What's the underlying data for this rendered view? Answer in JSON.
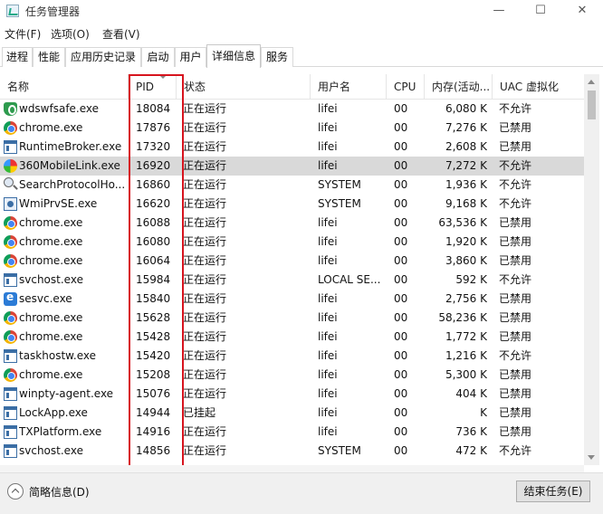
{
  "window": {
    "title": "任务管理器",
    "minimize": "—",
    "maximize": "☐",
    "close": "✕"
  },
  "menu": [
    "文件(F)",
    "选项(O)",
    "查看(V)"
  ],
  "tabs": [
    {
      "label": "进程"
    },
    {
      "label": "性能"
    },
    {
      "label": "应用历史记录"
    },
    {
      "label": "启动"
    },
    {
      "label": "用户"
    },
    {
      "label": "详细信息",
      "active": true
    },
    {
      "label": "服务"
    }
  ],
  "columns": {
    "name": "名称",
    "pid": "PID",
    "status": "状态",
    "user": "用户名",
    "cpu": "CPU",
    "memory": "内存(活动...",
    "uac": "UAC 虚拟化"
  },
  "rows": [
    {
      "icon": "shield-icon",
      "name": "wdswfsafe.exe",
      "pid": "18084",
      "status": "正在运行",
      "user": "lifei",
      "cpu": "00",
      "mem": "6,080 K",
      "uac": "不允许"
    },
    {
      "icon": "chrome-icon",
      "name": "chrome.exe",
      "pid": "17876",
      "status": "正在运行",
      "user": "lifei",
      "cpu": "00",
      "mem": "7,276 K",
      "uac": "已禁用"
    },
    {
      "icon": "window-icon",
      "name": "RuntimeBroker.exe",
      "pid": "17320",
      "status": "正在运行",
      "user": "lifei",
      "cpu": "00",
      "mem": "2,608 K",
      "uac": "已禁用"
    },
    {
      "icon": "360-icon",
      "name": "360MobileLink.exe",
      "pid": "16920",
      "status": "正在运行",
      "user": "lifei",
      "cpu": "00",
      "mem": "7,272 K",
      "uac": "不允许",
      "selected": true
    },
    {
      "icon": "search-icon",
      "name": "SearchProtocolHo...",
      "pid": "16860",
      "status": "正在运行",
      "user": "SYSTEM",
      "cpu": "00",
      "mem": "1,936 K",
      "uac": "不允许"
    },
    {
      "icon": "wmi-icon",
      "name": "WmiPrvSE.exe",
      "pid": "16620",
      "status": "正在运行",
      "user": "SYSTEM",
      "cpu": "00",
      "mem": "9,168 K",
      "uac": "不允许"
    },
    {
      "icon": "chrome-icon",
      "name": "chrome.exe",
      "pid": "16088",
      "status": "正在运行",
      "user": "lifei",
      "cpu": "00",
      "mem": "63,536 K",
      "uac": "已禁用"
    },
    {
      "icon": "chrome-icon",
      "name": "chrome.exe",
      "pid": "16080",
      "status": "正在运行",
      "user": "lifei",
      "cpu": "00",
      "mem": "1,920 K",
      "uac": "已禁用"
    },
    {
      "icon": "chrome-icon",
      "name": "chrome.exe",
      "pid": "16064",
      "status": "正在运行",
      "user": "lifei",
      "cpu": "00",
      "mem": "3,860 K",
      "uac": "已禁用"
    },
    {
      "icon": "window-icon",
      "name": "svchost.exe",
      "pid": "15984",
      "status": "正在运行",
      "user": "LOCAL SE...",
      "cpu": "00",
      "mem": "592 K",
      "uac": "不允许"
    },
    {
      "icon": "sesvc-icon",
      "name": "sesvc.exe",
      "pid": "15840",
      "status": "正在运行",
      "user": "lifei",
      "cpu": "00",
      "mem": "2,756 K",
      "uac": "已禁用"
    },
    {
      "icon": "chrome-icon",
      "name": "chrome.exe",
      "pid": "15628",
      "status": "正在运行",
      "user": "lifei",
      "cpu": "00",
      "mem": "58,236 K",
      "uac": "已禁用"
    },
    {
      "icon": "chrome-icon",
      "name": "chrome.exe",
      "pid": "15428",
      "status": "正在运行",
      "user": "lifei",
      "cpu": "00",
      "mem": "1,772 K",
      "uac": "已禁用"
    },
    {
      "icon": "window-icon",
      "name": "taskhostw.exe",
      "pid": "15420",
      "status": "正在运行",
      "user": "lifei",
      "cpu": "00",
      "mem": "1,216 K",
      "uac": "不允许"
    },
    {
      "icon": "chrome-icon",
      "name": "chrome.exe",
      "pid": "15208",
      "status": "正在运行",
      "user": "lifei",
      "cpu": "00",
      "mem": "5,300 K",
      "uac": "已禁用"
    },
    {
      "icon": "window-icon",
      "name": "winpty-agent.exe",
      "pid": "15076",
      "status": "正在运行",
      "user": "lifei",
      "cpu": "00",
      "mem": "404 K",
      "uac": "已禁用"
    },
    {
      "icon": "window-icon",
      "name": "LockApp.exe",
      "pid": "14944",
      "status": "已挂起",
      "user": "lifei",
      "cpu": "00",
      "mem": "K",
      "uac": "已禁用"
    },
    {
      "icon": "window-icon",
      "name": "TXPlatform.exe",
      "pid": "14916",
      "status": "正在运行",
      "user": "lifei",
      "cpu": "00",
      "mem": "736 K",
      "uac": "已禁用"
    },
    {
      "icon": "window-icon",
      "name": "svchost.exe",
      "pid": "14856",
      "status": "正在运行",
      "user": "SYSTEM",
      "cpu": "00",
      "mem": "472 K",
      "uac": "不允许"
    }
  ],
  "footer": {
    "fewer_details": "简略信息(D)",
    "end_task": "结束任务(E)"
  }
}
